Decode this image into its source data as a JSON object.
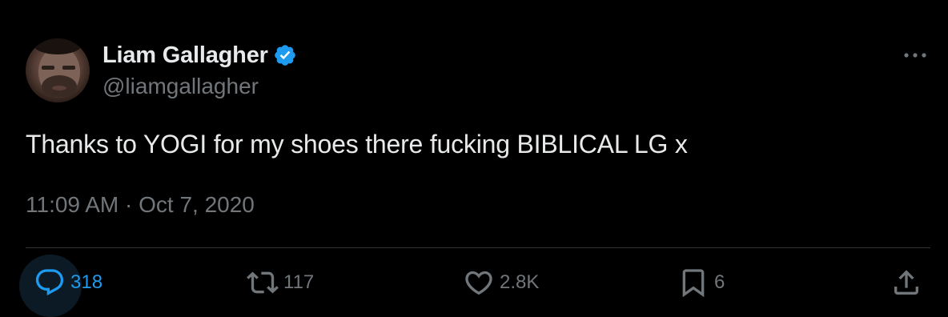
{
  "author": {
    "display_name": "Liam Gallagher",
    "handle": "@liamgallagher",
    "verified": true
  },
  "tweet": {
    "text": "Thanks to YOGI for my shoes there fucking BIBLICAL LG x",
    "timestamp": "11:09 AM · Oct 7, 2020"
  },
  "actions": {
    "replies": "318",
    "retweets": "117",
    "likes": "2.8K",
    "bookmarks": "6"
  },
  "icons": {
    "verified": "verified-badge-icon",
    "more": "more-options-icon",
    "reply": "reply-icon",
    "retweet": "retweet-icon",
    "like": "heart-icon",
    "bookmark": "bookmark-icon",
    "share": "share-icon"
  },
  "colors": {
    "background": "#000000",
    "text_primary": "#e7e9ea",
    "text_secondary": "#71767b",
    "accent": "#1d9bf0",
    "divider": "#2f3336"
  }
}
